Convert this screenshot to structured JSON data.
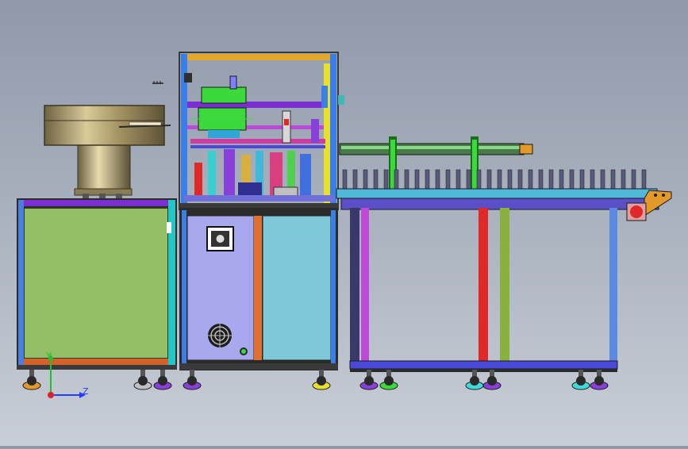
{
  "viewport": {
    "background_top": "#8f99a8",
    "background_bottom": "#c9ced6"
  },
  "triad": {
    "y_label": "Y",
    "z_label": "Z",
    "colors": {
      "x": "#e0202c",
      "y": "#1fbf2f",
      "z": "#2a3cff"
    }
  },
  "colors": {
    "cabinet_panel": "#95bf66",
    "cabinet_frame": "#3b6fd0",
    "control_panel": "#a8a8ee",
    "door_panel": "#7ec8d8",
    "bowl_metal": "#b9a977",
    "conveyor_frame": "#5b4fc8",
    "accent_orange": "#e39a2a",
    "accent_red": "#e02828",
    "module_green": "#3bd93b"
  },
  "icons": [
    "vibratory-bowl-feeder",
    "fan-grille-icon",
    "control-switch-icon",
    "caster-wheel-icon",
    "coordinate-triad-icon"
  ]
}
